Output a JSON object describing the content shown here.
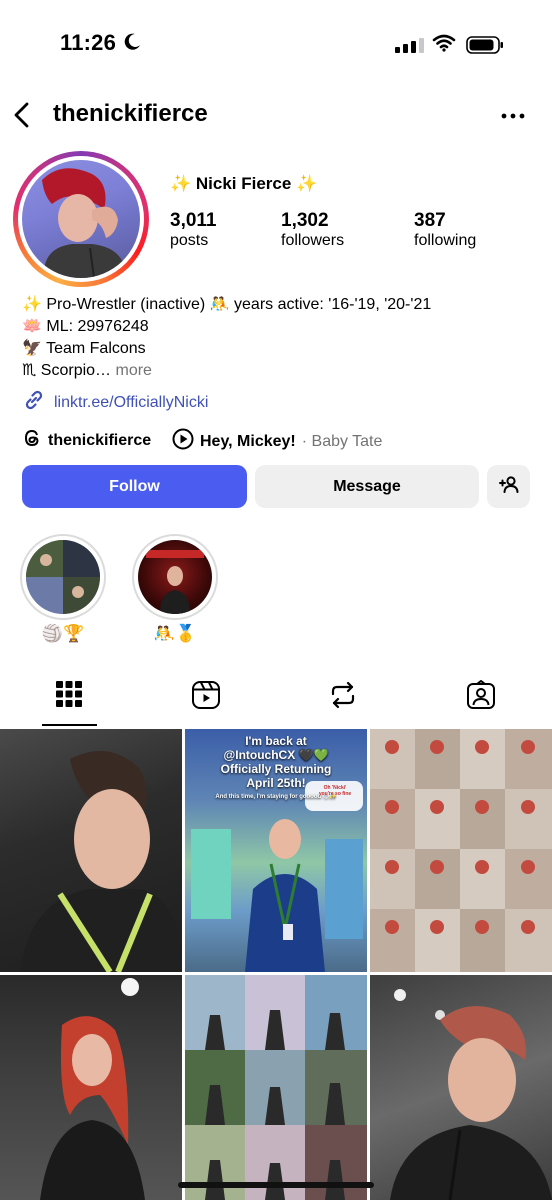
{
  "status_bar": {
    "time": "11:26"
  },
  "header": {
    "username": "thenickifierce"
  },
  "profile": {
    "display_name": "✨ Nicki Fierce ✨",
    "stats": [
      {
        "value": "3,011",
        "label": "posts"
      },
      {
        "value": "1,302",
        "label": "followers"
      },
      {
        "value": "387",
        "label": "following"
      }
    ],
    "bio": [
      "✨ Pro-Wrestler (inactive) 🤼 years active: '16-'19, '20-'21",
      "🪷 ML: 29976248",
      "🦅 Team Falcons",
      "♏ Scorpio…"
    ],
    "bio_more": "more",
    "link": "linktr.ee/OfficiallyNicki",
    "threads_handle": "thenickifierce",
    "song_title": "Hey, Mickey!",
    "song_artist": "· Baby Tate"
  },
  "actions": {
    "follow": "Follow",
    "message": "Message"
  },
  "highlights": [
    {
      "label": "🏐🏆"
    },
    {
      "label": "🤼🥇"
    }
  ],
  "posts": [
    {
      "overlay": ""
    },
    {
      "overlay_lines": [
        "I'm back at",
        "@IntouchCX 🖤💚",
        "Officially Returning",
        "April 25th!",
        "And this time, I'm staying for gooood 😊✨"
      ],
      "bubble_line1": "Oh 'Nicki'",
      "bubble_line2": "you're so fine"
    },
    {
      "overlay": ""
    },
    {
      "overlay": ""
    },
    {
      "overlay": ""
    },
    {
      "overlay": ""
    }
  ],
  "colors": {
    "accent": "#4a5df0",
    "link": "#3f51b5",
    "button_bg": "#efeff0"
  }
}
